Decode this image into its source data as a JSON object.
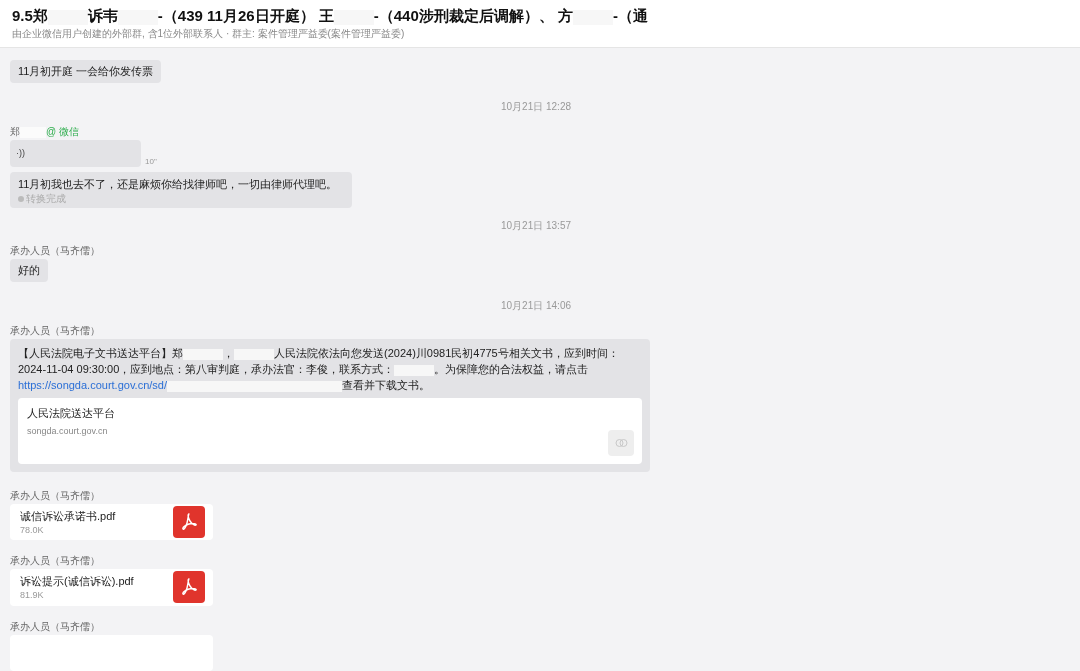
{
  "header": {
    "title": [
      {
        "kind": "text",
        "text": "9.5郑"
      },
      {
        "kind": "redacted"
      },
      {
        "kind": "text",
        "text": "诉韦"
      },
      {
        "kind": "redacted"
      },
      {
        "kind": "text",
        "text": "-（439 11月26日开庭） 王"
      },
      {
        "kind": "redacted"
      },
      {
        "kind": "text",
        "text": "-（440涉刑裁定后调解）、 方"
      },
      {
        "kind": "redacted"
      },
      {
        "kind": "text",
        "text": "-（通"
      }
    ],
    "subtitle": "由企业微信用户创建的外部群, 含1位外部联系人 · 群主: 案件管理严益委(案件管理严益委)"
  },
  "messages": [
    {
      "kind": "text",
      "text": "11月初开庭 一会给你发传票"
    },
    {
      "kind": "time",
      "text": "10月21日 12:28"
    },
    {
      "kind": "sender",
      "name": "郑",
      "redacted": true,
      "tag": "@ 微信"
    },
    {
      "kind": "voice",
      "icon": "·))",
      "duration": "10\""
    },
    {
      "kind": "transcript",
      "text": "11月初我也去不了，还是麻烦你给找律师吧，一切由律师代理吧。",
      "status": "转换完成"
    },
    {
      "kind": "time",
      "text": "10月21日 13:57"
    },
    {
      "kind": "sender",
      "name": "承办人员（马齐儒）"
    },
    {
      "kind": "text",
      "text": "好的"
    },
    {
      "kind": "time",
      "text": "10月21日 14:06"
    },
    {
      "kind": "sender",
      "name": "承办人员（马齐儒）"
    },
    {
      "kind": "rich",
      "parts": [
        {
          "kind": "text",
          "text": "【人民法院电子文书送达平台】郑"
        },
        {
          "kind": "redacted"
        },
        {
          "kind": "text",
          "text": "，"
        },
        {
          "kind": "redacted"
        },
        {
          "kind": "text",
          "text": "人民法院依法向您发送(2024)川0981民初4775号相关文书，应到时间：2024-11-04 09:30:00，应到地点：第八审判庭，承办法官：李俊，联系方式："
        },
        {
          "kind": "redacted"
        },
        {
          "kind": "text",
          "text": "。为保障您的合法权益，请点击 "
        },
        {
          "kind": "link",
          "text": "https://songda.court.gov.cn/sd/"
        },
        {
          "kind": "redacted_wide"
        },
        {
          "kind": "text",
          "text": "查看并下载文书。"
        }
      ],
      "card": {
        "title": "人民法院送达平台",
        "domain": "songda.court.gov.cn"
      }
    },
    {
      "kind": "sender",
      "name": "承办人员（马齐儒）"
    },
    {
      "kind": "file",
      "name": "诚信诉讼承诺书.pdf",
      "size": "78.0K"
    },
    {
      "kind": "sender",
      "name": "承办人员（马齐儒）"
    },
    {
      "kind": "file",
      "name": "诉讼提示(诚信诉讼).pdf",
      "size": "81.9K"
    },
    {
      "kind": "sender",
      "name": "承办人员（马齐儒）"
    },
    {
      "kind": "file_partial"
    }
  ]
}
